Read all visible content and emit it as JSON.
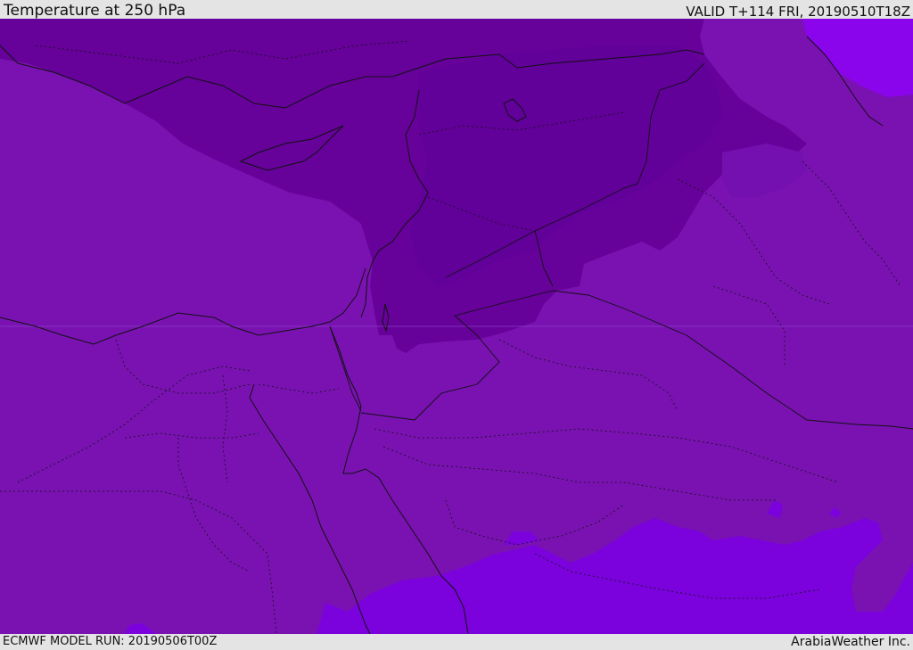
{
  "header": {
    "title": "Temperature at 250 hPa",
    "valid": "VALID T+114 FRI, 20190510T18Z"
  },
  "footer": {
    "model_run": "ECMWF MODEL RUN: 20190506T00Z",
    "credit": "ArabiaWeather Inc."
  },
  "map": {
    "colors": {
      "base": "#7a12b2",
      "dark": "#66029a",
      "darker": "#62009a",
      "light": "#7b02dc",
      "lighter": "#8a05ec"
    }
  }
}
